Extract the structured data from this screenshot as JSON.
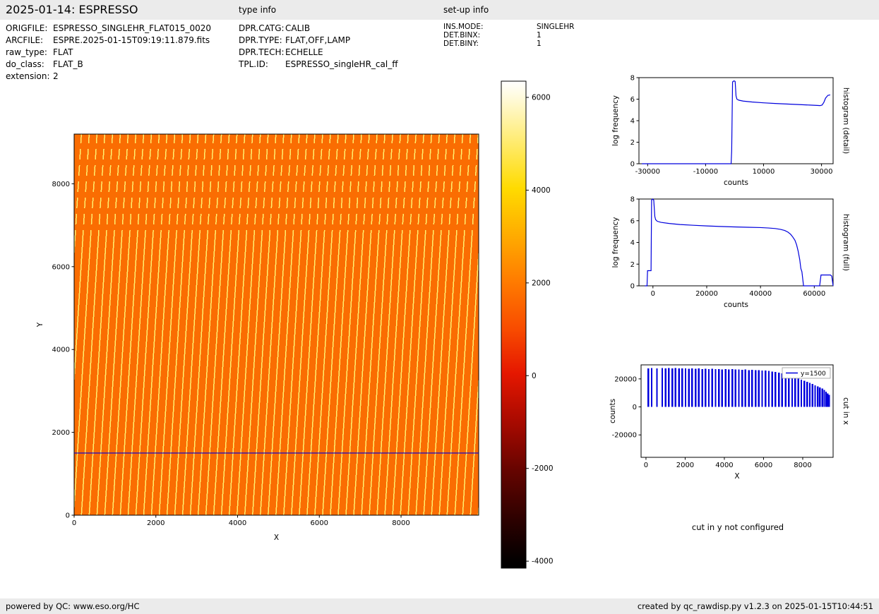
{
  "header": {
    "title": "2025-01-14: ESPRESSO",
    "type_info_label": "type info",
    "setup_info_label": "set-up info"
  },
  "metadata": {
    "file_info": [
      {
        "label": "ORIGFILE:",
        "value": "ESPRESSO_SINGLEHR_FLAT015_0020"
      },
      {
        "label": "ARCFILE:",
        "value": "ESPRE.2025-01-15T09:19:11.879.fits"
      },
      {
        "label": "raw_type:",
        "value": "FLAT"
      },
      {
        "label": "do_class:",
        "value": "FLAT_B"
      },
      {
        "label": "extension:",
        "value": "2"
      }
    ],
    "type_info": [
      {
        "label": "DPR.CATG:",
        "value": "CALIB"
      },
      {
        "label": "DPR.TYPE:",
        "value": "FLAT,OFF,LAMP"
      },
      {
        "label": "DPR.TECH:",
        "value": "ECHELLE"
      },
      {
        "label": "TPL.ID:",
        "value": "ESPRESSO_singleHR_cal_ff"
      }
    ],
    "setup_info": [
      {
        "label": "INS.MODE:",
        "value": "SINGLEHR"
      },
      {
        "label": "DET.BINX:",
        "value": "1"
      },
      {
        "label": "DET.BINY:",
        "value": "1"
      }
    ]
  },
  "colors": {
    "line_blue": "#0000dd",
    "image_orange": "#fa6d02",
    "image_stripe": "#ffee6e",
    "bar_gray": "#ebebeb"
  },
  "notes": {
    "cut_in_y": "cut in y not configured"
  },
  "footer": {
    "left": "powered by QC: www.eso.org/HC",
    "right": "created by qc_rawdisp.py v1.2.3 on 2025-01-15T10:44:51"
  },
  "chart_data": [
    {
      "id": "main-image",
      "type": "heatmap",
      "description": "Raw ESPRESSO flat-field frame: orange background with slanted yellow echelle-order stripes, dashed near top",
      "xlabel": "X",
      "ylabel": "Y",
      "xlim": [
        0,
        9900
      ],
      "ylim": [
        0,
        9200
      ],
      "xticks": [
        0,
        2000,
        4000,
        6000,
        8000
      ],
      "yticks": [
        0,
        2000,
        4000,
        6000,
        8000
      ],
      "cut_line_y": 1500
    },
    {
      "id": "colorbar",
      "type": "colorbar",
      "colormap": "hot",
      "vmin": -4150,
      "vmax": 6350,
      "ticks": [
        6000,
        4000,
        2000,
        0,
        -2000,
        -4000
      ],
      "gradient_stops": [
        [
          "#ffffff",
          0
        ],
        [
          "#fffbe0",
          3
        ],
        [
          "#ffec75",
          12
        ],
        [
          "#ffdb00",
          22
        ],
        [
          "#ffaa00",
          32
        ],
        [
          "#ff7c00",
          41
        ],
        [
          "#f84b00",
          51
        ],
        [
          "#e51700",
          60
        ],
        [
          "#a80a00",
          70
        ],
        [
          "#650400",
          80
        ],
        [
          "#2d0100",
          90
        ],
        [
          "#050000",
          98
        ],
        [
          "#000000",
          100
        ]
      ]
    },
    {
      "id": "hist-detail",
      "type": "line",
      "xlabel": "counts",
      "ylabel": "log frequency",
      "right_label": "histogram (detail)",
      "xlim": [
        -33000,
        34000
      ],
      "ylim": [
        0,
        8
      ],
      "xticks": [
        -30000,
        -10000,
        10000,
        30000
      ],
      "yticks": [
        0,
        2,
        4,
        6,
        8
      ],
      "x": [
        -32000,
        -1200,
        -1000,
        -700,
        -200,
        200,
        500,
        800,
        1500,
        3000,
        6000,
        10000,
        14000,
        18000,
        22000,
        26000,
        28500,
        29500,
        30200,
        30800,
        31400,
        32200,
        33000
      ],
      "y": [
        0,
        0,
        1.2,
        7.6,
        7.7,
        7.65,
        6.3,
        6.0,
        5.9,
        5.82,
        5.74,
        5.66,
        5.6,
        5.55,
        5.5,
        5.45,
        5.42,
        5.4,
        5.45,
        5.7,
        6.1,
        6.35,
        6.4
      ]
    },
    {
      "id": "hist-full",
      "type": "line",
      "xlabel": "counts",
      "ylabel": "log frequency",
      "right_label": "histogram (full)",
      "xlim": [
        -5200,
        67000
      ],
      "ylim": [
        0,
        8
      ],
      "xticks": [
        0,
        20000,
        40000,
        60000
      ],
      "yticks": [
        0,
        2,
        4,
        6,
        8
      ],
      "x": [
        -3000,
        -2200,
        -2000,
        -700,
        -500,
        -100,
        300,
        700,
        1000,
        1600,
        3000,
        6000,
        10000,
        15000,
        20000,
        25000,
        30000,
        35000,
        40000,
        43000,
        45500,
        47500,
        49000,
        50200,
        51200,
        52000,
        52800,
        53400,
        54000,
        54600,
        55000,
        55400,
        56000,
        62000,
        62500,
        66000,
        66500,
        67000
      ],
      "y": [
        0,
        0,
        1.4,
        1.4,
        7.9,
        8.0,
        7.9,
        6.4,
        6.1,
        5.95,
        5.85,
        5.75,
        5.65,
        5.58,
        5.52,
        5.47,
        5.43,
        5.4,
        5.37,
        5.33,
        5.28,
        5.2,
        5.1,
        4.95,
        4.75,
        4.5,
        4.2,
        3.8,
        3.2,
        2.4,
        1.6,
        1.3,
        0,
        0,
        1.0,
        1.0,
        0.9,
        0
      ]
    },
    {
      "id": "cut-x",
      "type": "bars",
      "xlabel": "X",
      "ylabel": "counts",
      "right_label": "cut in x",
      "legend": "y=1500",
      "xlim": [
        -250,
        9550
      ],
      "ylim": [
        -36000,
        30000
      ],
      "xticks": [
        0,
        2000,
        4000,
        6000,
        8000
      ],
      "yticks": [
        -20000,
        0,
        20000
      ],
      "bars": [
        [
          120,
          27600
        ],
        [
          290,
          27800
        ],
        [
          560,
          27500
        ],
        [
          830,
          27700
        ],
        [
          1000,
          27600
        ],
        [
          1170,
          27800
        ],
        [
          1340,
          27500
        ],
        [
          1510,
          27700
        ],
        [
          1680,
          27600
        ],
        [
          1850,
          27400
        ],
        [
          2020,
          27600
        ],
        [
          2190,
          27300
        ],
        [
          2360,
          27500
        ],
        [
          2530,
          27200
        ],
        [
          2700,
          27400
        ],
        [
          2870,
          27100
        ],
        [
          3040,
          27300
        ],
        [
          3210,
          27000
        ],
        [
          3380,
          27200
        ],
        [
          3550,
          26900
        ],
        [
          3720,
          27100
        ],
        [
          3890,
          26800
        ],
        [
          4060,
          27000
        ],
        [
          4230,
          26700
        ],
        [
          4400,
          26900
        ],
        [
          4570,
          26600
        ],
        [
          4740,
          26800
        ],
        [
          4910,
          26500
        ],
        [
          5080,
          26600
        ],
        [
          5250,
          26300
        ],
        [
          5420,
          26400
        ],
        [
          5590,
          26100
        ],
        [
          5760,
          26200
        ],
        [
          5930,
          25900
        ],
        [
          6100,
          25900
        ],
        [
          6270,
          25600
        ],
        [
          6440,
          25300
        ],
        [
          6610,
          24900
        ],
        [
          6780,
          24400
        ],
        [
          6950,
          23900
        ],
        [
          7120,
          23300
        ],
        [
          7290,
          22600
        ],
        [
          7460,
          21900
        ],
        [
          7620,
          21100
        ],
        [
          7780,
          20300
        ],
        [
          7930,
          19500
        ],
        [
          8080,
          18700
        ],
        [
          8220,
          17900
        ],
        [
          8360,
          17100
        ],
        [
          8500,
          16300
        ],
        [
          8630,
          15500
        ],
        [
          8760,
          14700
        ],
        [
          8880,
          13900
        ],
        [
          9000,
          13000
        ],
        [
          9100,
          12000
        ],
        [
          9190,
          10800
        ],
        [
          9270,
          9600
        ],
        [
          9340,
          8500
        ]
      ]
    }
  ]
}
